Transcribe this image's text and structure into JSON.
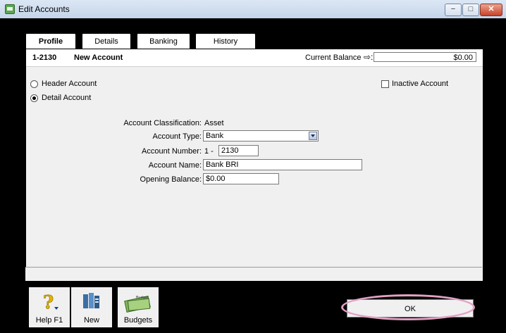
{
  "window": {
    "title": "Edit Accounts",
    "minimize_glyph": "−",
    "maximize_glyph": "□",
    "close_glyph": "✕"
  },
  "tabs": [
    {
      "label": "Profile",
      "key": "P"
    },
    {
      "label": "Details",
      "key": "D"
    },
    {
      "label": "Banking",
      "key": "k"
    },
    {
      "label": "History",
      "key": "y"
    }
  ],
  "header": {
    "account_code": "1-2130",
    "account_title": "New Account",
    "current_balance_label": "Current Balance",
    "current_balance_arrow": "⇨:",
    "current_balance_value": "$0.00"
  },
  "form": {
    "header_account_label": "Header Account",
    "detail_account_label": "Detail Account",
    "detail_selected": true,
    "inactive_label": "Inactive Account",
    "inactive_checked": false,
    "classification_label": "Account Classification:",
    "classification_value": "Asset",
    "type_label": "Account Type:",
    "type_value": "Bank",
    "number_label": "Account Number:",
    "number_prefix": "1 -",
    "number_value": "2130",
    "name_label": "Account Name:",
    "name_value": "Bank BRI",
    "opening_label": "Opening Balance:",
    "opening_value": "$0.00"
  },
  "toolbar": {
    "help_label": "Help F1",
    "new_label": "New",
    "budgets_label": "Budgets",
    "budget_icon_text": "Budget"
  },
  "ok_label": "OK",
  "icons": {
    "app": "accounts-icon",
    "help": "help-question-icon",
    "new": "new-account-icon",
    "budgets": "budget-money-icon"
  },
  "colors": {
    "accent_ring": "#e2a1c3",
    "title_bg": "#dce7f4",
    "close_red": "#c9432a"
  }
}
